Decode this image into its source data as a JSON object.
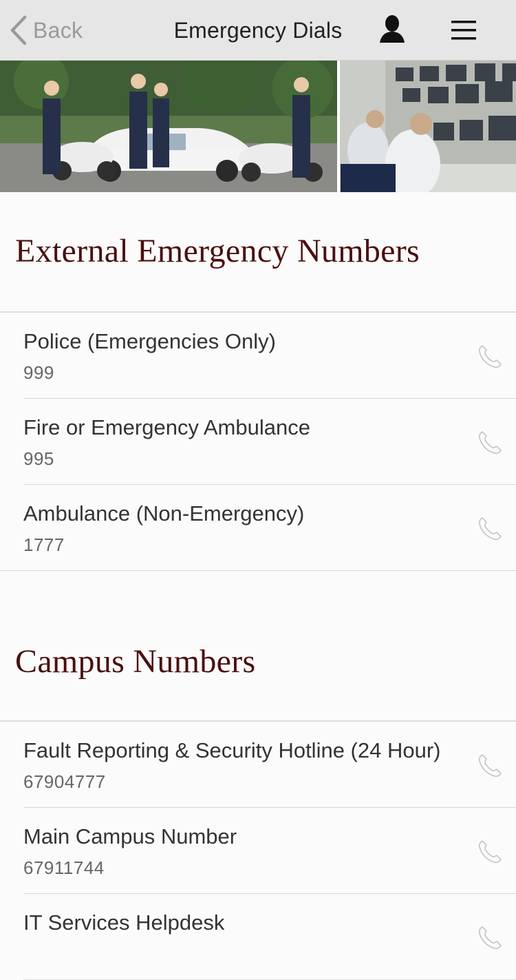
{
  "navbar": {
    "back_label": "Back",
    "title": "Emergency Dials",
    "profile_icon": "user-icon",
    "menu_icon": "hamburger-menu-icon"
  },
  "banner": {
    "description_icon": "campus-security-photo"
  },
  "external": {
    "heading": "External Emergency Numbers",
    "items": [
      {
        "title": "Police (Emergencies Only)",
        "number": "999"
      },
      {
        "title": "Fire or Emergency Ambulance",
        "number": "995"
      },
      {
        "title": "Ambulance (Non-Emergency)",
        "number": "1777"
      }
    ]
  },
  "campus": {
    "heading": "Campus Numbers",
    "items": [
      {
        "title": "Fault Reporting & Security Hotline (24 Hour)",
        "number": "67904777"
      },
      {
        "title": "Main Campus Number",
        "number": "67911744"
      },
      {
        "title": "IT Services Helpdesk",
        "number": ""
      }
    ]
  },
  "colors": {
    "navbar_bg": "#e6e6e6",
    "heading": "#4a0f0f",
    "text": "#333333",
    "icon_muted": "#c8c8c8"
  }
}
